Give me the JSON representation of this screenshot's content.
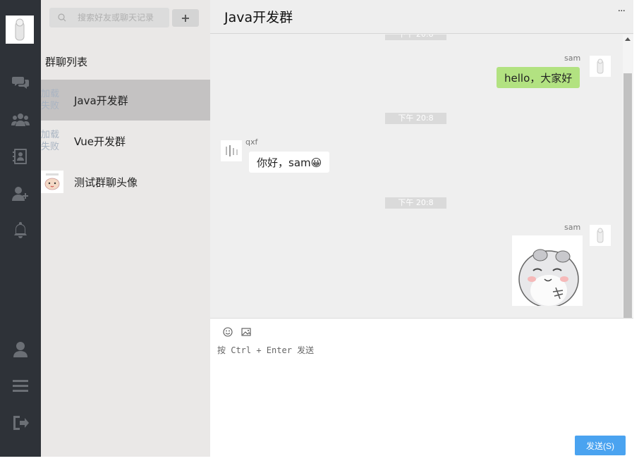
{
  "sidebar": {
    "icons": [
      "chat-icon",
      "group-icon",
      "contacts-icon",
      "add-user-icon",
      "bell-icon",
      "user-icon",
      "menu-icon",
      "logout-icon"
    ]
  },
  "search": {
    "placeholder": "搜索好友或聊天记录"
  },
  "add_button": {
    "label": "+"
  },
  "group_list": {
    "title": "群聊列表",
    "items": [
      {
        "name": "Java开发群",
        "avatar_fallback": "加载失败",
        "active": true
      },
      {
        "name": "Vue开发群",
        "avatar_fallback": "加载失败",
        "active": false
      },
      {
        "name": "测试群聊头像",
        "avatar_fallback": "",
        "active": false
      }
    ]
  },
  "chat": {
    "title": "Java开发群",
    "more_label": "···",
    "messages": [
      {
        "time": "下午 20:8",
        "sender": "sam",
        "self": true,
        "text": "hello，大家好"
      },
      {
        "time": "下午 20:8",
        "sender": "qxf",
        "self": false,
        "text": "你好，sam😀"
      },
      {
        "time": "下午 20:8",
        "sender": "sam",
        "self": true,
        "image": "hamster-sticker"
      }
    ]
  },
  "composer": {
    "placeholder": "按 Ctrl + Enter 发送",
    "tools": [
      "emoji-icon",
      "image-icon"
    ],
    "send_label": "发送(S)"
  },
  "colors": {
    "rail": "#2e3238",
    "self_bubble": "#b2e281",
    "send_button": "#4aa3f0"
  }
}
